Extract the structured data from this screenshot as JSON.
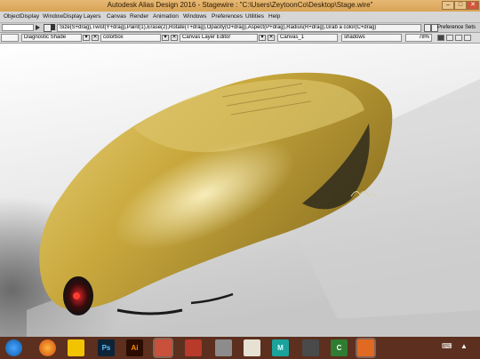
{
  "window": {
    "title": "Autodesk Alias Design 2016   - Stagewire : \"C:\\Users\\ZeytoonCo\\Desktop\\Stage.wire\"",
    "minimize": "–",
    "maximize": "□",
    "close": "✕"
  },
  "menu": [
    "ObjectDisplay",
    "WindowDisplay",
    "Layers",
    "Canvas",
    "Render",
    "Animation",
    "Windows",
    "Preferences",
    "Utilities",
    "Help"
  ],
  "toolbar": {
    "hint": "Size(S+drag),Twist(Y+drag),Paint(1),Erase(2),Rotate(T+drag),Opacity(O+drag),Aspect(P+drag),Radius(R+drag),Grab a color(C+drag)",
    "preference_sets": "Preference Sets"
  },
  "panels": {
    "shade": "Diagnostic Shade",
    "colorbox": "colorbox",
    "layer_editor": "Canvas Layer Editor",
    "canvas_name": "Canvas_1",
    "layer_name": "shadows",
    "opacity": "78%"
  },
  "taskbar": {
    "apps": [
      "windows-start",
      "firefox",
      "irancell",
      "photoshop",
      "illustrator",
      "autodesk-alias",
      "autodesk-app",
      "files",
      "sketchbook",
      "maya",
      "media",
      "camtasia",
      "video-player"
    ],
    "labels": {
      "photoshop": "Ps",
      "illustrator": "Ai",
      "maya": "M",
      "camtasia": "C"
    }
  },
  "colors": {
    "title_bar": "#dba860",
    "car_body": "#c9a93e",
    "taskbar": "#5c2f1e"
  }
}
